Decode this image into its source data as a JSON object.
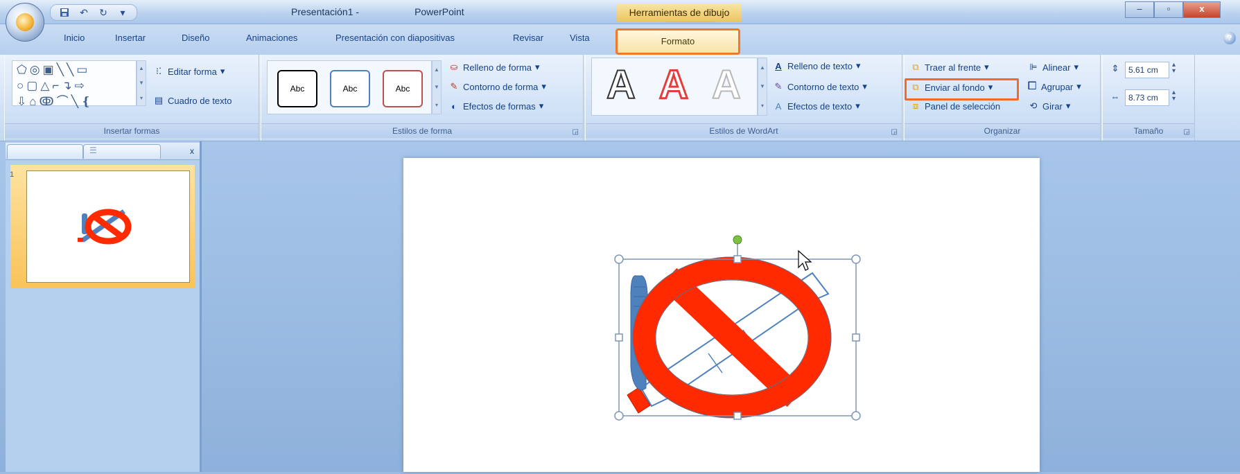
{
  "title_bar": {
    "title": "Presentación1 -",
    "app_name": "PowerPoint",
    "context_tab_title": "Herramientas de dibujo"
  },
  "tabs": [
    "Inicio",
    "Insertar",
    "Diseño",
    "Animaciones",
    "Presentación con diapositivas",
    "Revisar",
    "Vista"
  ],
  "active_tab": "Formato",
  "ribbon": {
    "insertar_formas": {
      "label": "Insertar formas",
      "editar_forma": "Editar forma",
      "cuadro_texto": "Cuadro de texto"
    },
    "estilos_forma": {
      "label": "Estilos de forma",
      "abc": [
        "Abc",
        "Abc",
        "Abc"
      ],
      "relleno": "Relleno de forma",
      "contorno": "Contorno de forma",
      "efectos": "Efectos de formas"
    },
    "wordart": {
      "label": "Estilos de WordArt",
      "letter": "A",
      "relleno": "Relleno de texto",
      "contorno": "Contorno de texto",
      "efectos": "Efectos de texto"
    },
    "organizar": {
      "label": "Organizar",
      "traer": "Traer al frente",
      "enviar": "Enviar al fondo",
      "panel": "Panel de selección",
      "alinear": "Alinear",
      "agrupar": "Agrupar",
      "girar": "Girar"
    },
    "tamano": {
      "label": "Tamaño",
      "height": "5.61 cm",
      "width": "8.73 cm"
    }
  },
  "slides_panel": {
    "slide_number": "1",
    "close": "x"
  },
  "colors": {
    "prohibition_red": "#ff2a00",
    "hand_blue": "#4f81bd",
    "handle_green": "#7cc142",
    "highlight_orange": "#f06a2a"
  }
}
